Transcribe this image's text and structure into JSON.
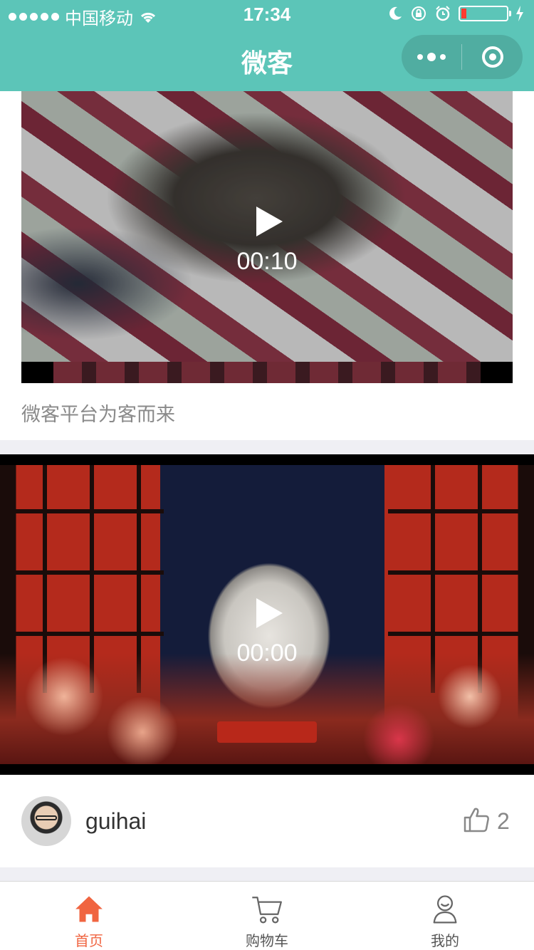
{
  "status_bar": {
    "carrier": "中国移动",
    "time": "17:34",
    "battery_level": 0.12,
    "battery_color": "#ff3b30"
  },
  "nav": {
    "title": "微客",
    "background": "#5cc5b8",
    "more_icon": "more-dots-icon",
    "close_icon": "target-ring-icon"
  },
  "feed": [
    {
      "duration": "00:10",
      "caption": "微客平台为客而来"
    },
    {
      "duration": "00:00",
      "author": "guihai",
      "likes": "2"
    }
  ],
  "tabbar": {
    "accent": "#f06541",
    "tabs": [
      {
        "label": "首页",
        "icon": "home-icon",
        "active": true
      },
      {
        "label": "购物车",
        "icon": "cart-icon",
        "active": false
      },
      {
        "label": "我的",
        "icon": "user-icon",
        "active": false
      }
    ]
  }
}
